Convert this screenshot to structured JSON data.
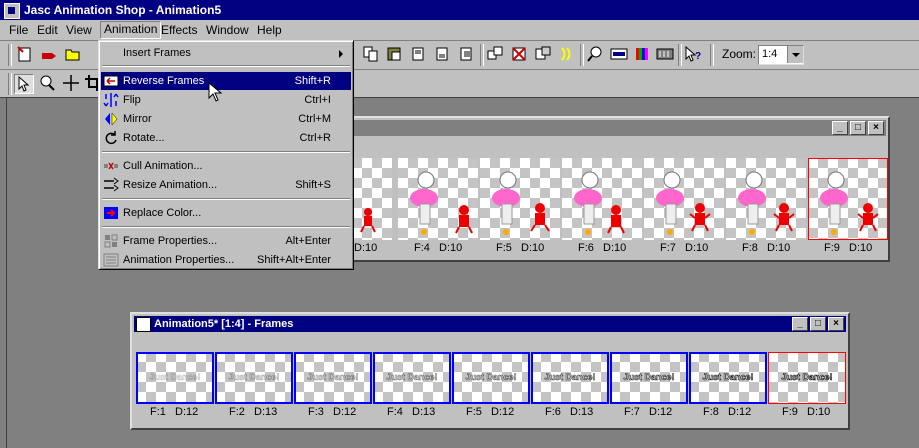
{
  "app": {
    "title": "Jasc Animation Shop - Animation5"
  },
  "menubar": {
    "items": [
      "File",
      "Edit",
      "View",
      "Animation",
      "Effects",
      "Window",
      "Help"
    ]
  },
  "toolbar": {
    "zoom_label": "Zoom:",
    "zoom_value": "1:4"
  },
  "animation_menu": {
    "items": [
      {
        "label": "Insert Frames",
        "shortcut": "",
        "icon": "none",
        "submenu": true
      },
      {
        "label": "Reverse Frames",
        "shortcut": "Shift+R",
        "icon": "reverse-frames-icon",
        "highlighted": true
      },
      {
        "label": "Flip",
        "shortcut": "Ctrl+I",
        "icon": "flip-icon"
      },
      {
        "label": "Mirror",
        "shortcut": "Ctrl+M",
        "icon": "mirror-icon"
      },
      {
        "label": "Rotate...",
        "shortcut": "Ctrl+R",
        "icon": "rotate-icon"
      },
      {
        "label": "Cull Animation...",
        "shortcut": "",
        "icon": "cull-icon"
      },
      {
        "label": "Resize Animation...",
        "shortcut": "Shift+S",
        "icon": "resize-icon"
      },
      {
        "label": "Replace Color...",
        "shortcut": "",
        "icon": "replace-color-icon"
      },
      {
        "label": "Frame Properties...",
        "shortcut": "Alt+Enter",
        "icon": "frame-properties-icon"
      },
      {
        "label": "Animation Properties...",
        "shortcut": "Shift+Alt+Enter",
        "icon": "animation-properties-icon"
      }
    ]
  },
  "window_top": {
    "title": "",
    "frames": [
      {
        "label": "D:10"
      },
      {
        "label": "F:4   D:10"
      },
      {
        "label": "F:5   D:10"
      },
      {
        "label": "F:6   D:10"
      },
      {
        "label": "F:7   D:10"
      },
      {
        "label": "F:8   D:10"
      },
      {
        "label": "F:9   D:10"
      }
    ]
  },
  "window_bottom": {
    "title": "Animation5* [1:4] - Frames",
    "frame_text": [
      "Just Dance!",
      "Just Dance!",
      "Just Dance!",
      "Just Dance!",
      "Just Dance!",
      "Just Dance!",
      "Just Dance!",
      "Just Dance!",
      "Just Dance!"
    ],
    "frames": [
      {
        "label": "F:1   D:12"
      },
      {
        "label": "F:2   D:13"
      },
      {
        "label": "F:3   D:12"
      },
      {
        "label": "F:4   D:13"
      },
      {
        "label": "F:5   D:12"
      },
      {
        "label": "F:6   D:13"
      },
      {
        "label": "F:7   D:12"
      },
      {
        "label": "F:8   D:12"
      },
      {
        "label": "F:9   D:10"
      }
    ]
  },
  "colors": {
    "title_active": "#000080",
    "face": "#c0c0c0",
    "workspace": "#808080",
    "selected_frame": "#0000ff",
    "current_frame": "#ff0000"
  }
}
